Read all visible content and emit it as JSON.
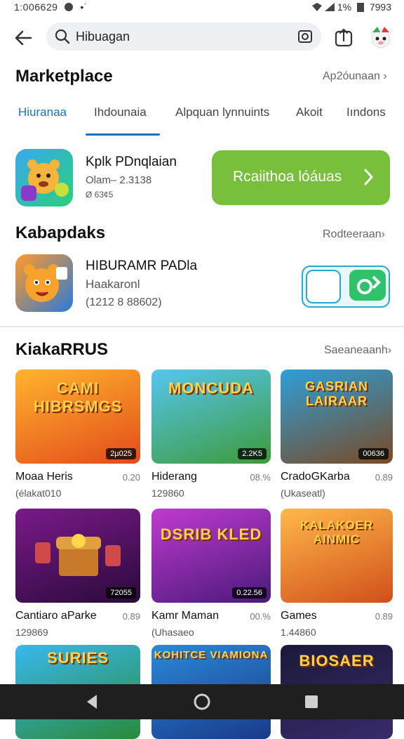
{
  "status": {
    "time": "1:006629",
    "battery": "1%",
    "clock": "7993"
  },
  "search": {
    "query": "Hibuagan"
  },
  "marketplace": {
    "title": "Marketplace",
    "more": "Ap2óunaan"
  },
  "tabs": [
    {
      "label": "Hiuranaa",
      "active": true
    },
    {
      "label": "Ihdounaia",
      "active": false
    },
    {
      "label": "Alpquan lynnuints",
      "active": false
    },
    {
      "label": "Akoit",
      "active": false
    },
    {
      "label": "Iındons",
      "active": false
    }
  ],
  "featured": {
    "name": "Kplk PDnqlaian",
    "sub1": "Olam– 2.3138",
    "sub2": "Ø 63¢5",
    "button": "Rcaiithoa lóáuas"
  },
  "section2": {
    "title": "Kabapdaks",
    "more": "Rodteeraan",
    "app_name": "HIBURAMR PADla",
    "app_sub": "Haakaronl",
    "app_count": "(1212 8 88602)"
  },
  "section3": {
    "title": "KiakaRRUS",
    "more": "Saeaneaanh"
  },
  "cards": [
    {
      "thumb_title": "CAMI HIBRSMGS",
      "badge": "2µ025",
      "name": "Moaa Heris",
      "rating": "0.20",
      "sub": "(élakat010",
      "bg1": "#ffb42e",
      "bg2": "#e34b1a"
    },
    {
      "thumb_title": "MONCUDA",
      "badge": "2.2K5",
      "name": "Hiderang",
      "rating": "08.%",
      "sub": "129860",
      "bg1": "#55c6f0",
      "bg2": "#3d9a3a"
    },
    {
      "thumb_title": "GASRIAN LAIRAAR",
      "badge": "00636",
      "name": "CradoGKarba",
      "rating": "0.89",
      "sub": "(Ukaseatl)",
      "bg1": "#2d9fd9",
      "bg2": "#7a4a25"
    },
    {
      "thumb_title": "",
      "badge": "72055",
      "name": "Cantiaro aParke",
      "rating": "0.89",
      "sub": "129869",
      "bg1": "#7a1a8a",
      "bg2": "#2a0a3a"
    },
    {
      "thumb_title": "DSRIB KLED",
      "badge": "0.22.56",
      "name": "Kamr Maman",
      "rating": "00.%",
      "sub": "(Uhasaeo",
      "bg1": "#c03ad0",
      "bg2": "#4a1a7a"
    },
    {
      "thumb_title": "KALAKOER AINMIC",
      "badge": "",
      "name": "Games",
      "rating": "0.89",
      "sub": "1.44860",
      "bg1": "#ffb84a",
      "bg2": "#d0501a"
    },
    {
      "thumb_title": "SURIES",
      "badge": "",
      "name": "",
      "rating": "",
      "sub": "",
      "bg1": "#38b8f0",
      "bg2": "#2a8a3a"
    },
    {
      "thumb_title": "KOHITCE VIAMIONA",
      "badge": "",
      "name": "",
      "rating": "",
      "sub": "",
      "bg1": "#2a8ad8",
      "bg2": "#1a3a8a"
    },
    {
      "thumb_title": "BIOSAER",
      "badge": "",
      "name": "",
      "rating": "",
      "sub": "",
      "bg1": "#1a1a3a",
      "bg2": "#3a2a6a"
    }
  ],
  "colors": {
    "accent": "#1a73b8",
    "green": "#78bf3b",
    "toggle_border": "#27a9d0"
  }
}
